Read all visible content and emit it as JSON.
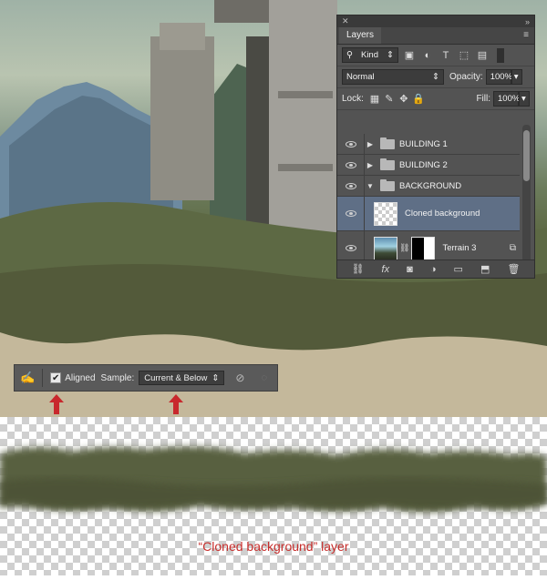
{
  "layers_panel": {
    "tab_label": "Layers",
    "filter_kind": "Kind",
    "blend_mode": "Normal",
    "opacity_label": "Opacity:",
    "opacity_value": "100%",
    "lock_label": "Lock:",
    "fill_label": "Fill:",
    "fill_value": "100%",
    "layers": [
      {
        "name": "BUILDING 1"
      },
      {
        "name": "BUILDING 2"
      },
      {
        "name": "BACKGROUND"
      },
      {
        "name": "Cloned background"
      },
      {
        "name": "Terrain 3"
      }
    ]
  },
  "options_bar": {
    "aligned_label": "Aligned",
    "sample_label": "Sample:",
    "sample_value": "Current & Below"
  },
  "caption": "“Cloned background” layer",
  "colors": {
    "panel_bg": "#535353",
    "selected_row": "#5f6f86",
    "annotation_red": "#c72d2b"
  }
}
